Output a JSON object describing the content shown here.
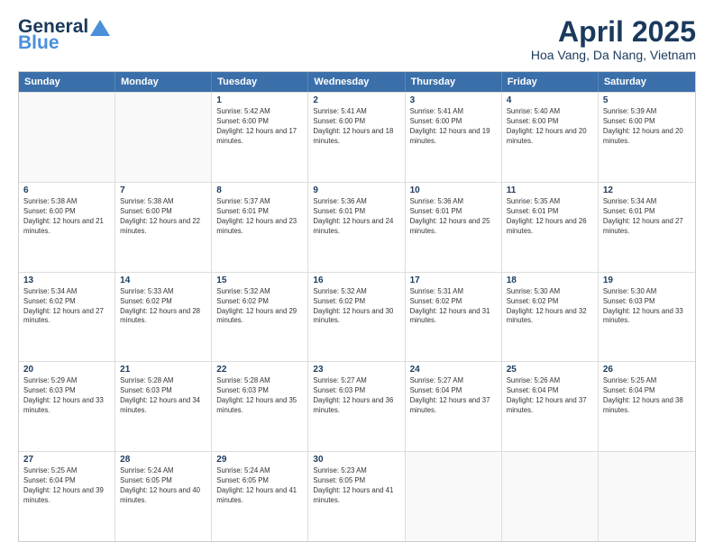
{
  "header": {
    "logo_general": "General",
    "logo_blue": "Blue",
    "title": "April 2025",
    "location": "Hoa Vang, Da Nang, Vietnam"
  },
  "days_of_week": [
    "Sunday",
    "Monday",
    "Tuesday",
    "Wednesday",
    "Thursday",
    "Friday",
    "Saturday"
  ],
  "weeks": [
    [
      {
        "day": "",
        "sunrise": "",
        "sunset": "",
        "daylight": ""
      },
      {
        "day": "",
        "sunrise": "",
        "sunset": "",
        "daylight": ""
      },
      {
        "day": "1",
        "sunrise": "Sunrise: 5:42 AM",
        "sunset": "Sunset: 6:00 PM",
        "daylight": "Daylight: 12 hours and 17 minutes."
      },
      {
        "day": "2",
        "sunrise": "Sunrise: 5:41 AM",
        "sunset": "Sunset: 6:00 PM",
        "daylight": "Daylight: 12 hours and 18 minutes."
      },
      {
        "day": "3",
        "sunrise": "Sunrise: 5:41 AM",
        "sunset": "Sunset: 6:00 PM",
        "daylight": "Daylight: 12 hours and 19 minutes."
      },
      {
        "day": "4",
        "sunrise": "Sunrise: 5:40 AM",
        "sunset": "Sunset: 6:00 PM",
        "daylight": "Daylight: 12 hours and 20 minutes."
      },
      {
        "day": "5",
        "sunrise": "Sunrise: 5:39 AM",
        "sunset": "Sunset: 6:00 PM",
        "daylight": "Daylight: 12 hours and 20 minutes."
      }
    ],
    [
      {
        "day": "6",
        "sunrise": "Sunrise: 5:38 AM",
        "sunset": "Sunset: 6:00 PM",
        "daylight": "Daylight: 12 hours and 21 minutes."
      },
      {
        "day": "7",
        "sunrise": "Sunrise: 5:38 AM",
        "sunset": "Sunset: 6:00 PM",
        "daylight": "Daylight: 12 hours and 22 minutes."
      },
      {
        "day": "8",
        "sunrise": "Sunrise: 5:37 AM",
        "sunset": "Sunset: 6:01 PM",
        "daylight": "Daylight: 12 hours and 23 minutes."
      },
      {
        "day": "9",
        "sunrise": "Sunrise: 5:36 AM",
        "sunset": "Sunset: 6:01 PM",
        "daylight": "Daylight: 12 hours and 24 minutes."
      },
      {
        "day": "10",
        "sunrise": "Sunrise: 5:36 AM",
        "sunset": "Sunset: 6:01 PM",
        "daylight": "Daylight: 12 hours and 25 minutes."
      },
      {
        "day": "11",
        "sunrise": "Sunrise: 5:35 AM",
        "sunset": "Sunset: 6:01 PM",
        "daylight": "Daylight: 12 hours and 26 minutes."
      },
      {
        "day": "12",
        "sunrise": "Sunrise: 5:34 AM",
        "sunset": "Sunset: 6:01 PM",
        "daylight": "Daylight: 12 hours and 27 minutes."
      }
    ],
    [
      {
        "day": "13",
        "sunrise": "Sunrise: 5:34 AM",
        "sunset": "Sunset: 6:02 PM",
        "daylight": "Daylight: 12 hours and 27 minutes."
      },
      {
        "day": "14",
        "sunrise": "Sunrise: 5:33 AM",
        "sunset": "Sunset: 6:02 PM",
        "daylight": "Daylight: 12 hours and 28 minutes."
      },
      {
        "day": "15",
        "sunrise": "Sunrise: 5:32 AM",
        "sunset": "Sunset: 6:02 PM",
        "daylight": "Daylight: 12 hours and 29 minutes."
      },
      {
        "day": "16",
        "sunrise": "Sunrise: 5:32 AM",
        "sunset": "Sunset: 6:02 PM",
        "daylight": "Daylight: 12 hours and 30 minutes."
      },
      {
        "day": "17",
        "sunrise": "Sunrise: 5:31 AM",
        "sunset": "Sunset: 6:02 PM",
        "daylight": "Daylight: 12 hours and 31 minutes."
      },
      {
        "day": "18",
        "sunrise": "Sunrise: 5:30 AM",
        "sunset": "Sunset: 6:02 PM",
        "daylight": "Daylight: 12 hours and 32 minutes."
      },
      {
        "day": "19",
        "sunrise": "Sunrise: 5:30 AM",
        "sunset": "Sunset: 6:03 PM",
        "daylight": "Daylight: 12 hours and 33 minutes."
      }
    ],
    [
      {
        "day": "20",
        "sunrise": "Sunrise: 5:29 AM",
        "sunset": "Sunset: 6:03 PM",
        "daylight": "Daylight: 12 hours and 33 minutes."
      },
      {
        "day": "21",
        "sunrise": "Sunrise: 5:28 AM",
        "sunset": "Sunset: 6:03 PM",
        "daylight": "Daylight: 12 hours and 34 minutes."
      },
      {
        "day": "22",
        "sunrise": "Sunrise: 5:28 AM",
        "sunset": "Sunset: 6:03 PM",
        "daylight": "Daylight: 12 hours and 35 minutes."
      },
      {
        "day": "23",
        "sunrise": "Sunrise: 5:27 AM",
        "sunset": "Sunset: 6:03 PM",
        "daylight": "Daylight: 12 hours and 36 minutes."
      },
      {
        "day": "24",
        "sunrise": "Sunrise: 5:27 AM",
        "sunset": "Sunset: 6:04 PM",
        "daylight": "Daylight: 12 hours and 37 minutes."
      },
      {
        "day": "25",
        "sunrise": "Sunrise: 5:26 AM",
        "sunset": "Sunset: 6:04 PM",
        "daylight": "Daylight: 12 hours and 37 minutes."
      },
      {
        "day": "26",
        "sunrise": "Sunrise: 5:25 AM",
        "sunset": "Sunset: 6:04 PM",
        "daylight": "Daylight: 12 hours and 38 minutes."
      }
    ],
    [
      {
        "day": "27",
        "sunrise": "Sunrise: 5:25 AM",
        "sunset": "Sunset: 6:04 PM",
        "daylight": "Daylight: 12 hours and 39 minutes."
      },
      {
        "day": "28",
        "sunrise": "Sunrise: 5:24 AM",
        "sunset": "Sunset: 6:05 PM",
        "daylight": "Daylight: 12 hours and 40 minutes."
      },
      {
        "day": "29",
        "sunrise": "Sunrise: 5:24 AM",
        "sunset": "Sunset: 6:05 PM",
        "daylight": "Daylight: 12 hours and 41 minutes."
      },
      {
        "day": "30",
        "sunrise": "Sunrise: 5:23 AM",
        "sunset": "Sunset: 6:05 PM",
        "daylight": "Daylight: 12 hours and 41 minutes."
      },
      {
        "day": "",
        "sunrise": "",
        "sunset": "",
        "daylight": ""
      },
      {
        "day": "",
        "sunrise": "",
        "sunset": "",
        "daylight": ""
      },
      {
        "day": "",
        "sunrise": "",
        "sunset": "",
        "daylight": ""
      }
    ]
  ]
}
